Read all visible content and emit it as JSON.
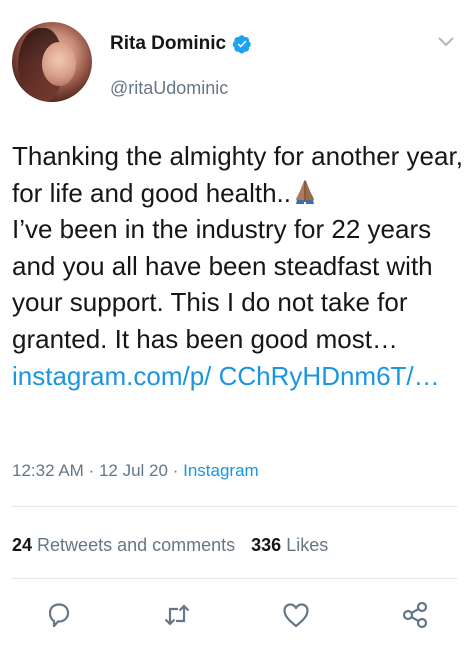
{
  "tweet": {
    "author_name": "Rita Dominic",
    "handle": "@ritaUdominic",
    "text_line_1": "Thanking the almighty for another year, for life and good health..",
    "text_line_2": "I’ve been in the industry for 22 years and you all have been steadfast with your support. This I do not take for granted. It has been good most… ",
    "link_text": "instagram.com/p/ CChRyHDnm6T/…",
    "time": "12:32 AM",
    "date": "12 Jul 20",
    "source": "Instagram"
  },
  "stats": {
    "retweets_count": "24",
    "retweets_label": "Retweets and comments",
    "likes_count": "336",
    "likes_label": "Likes"
  },
  "icons": {
    "verified": "verified-badge-icon",
    "chevron": "chevron-down-icon",
    "emoji": "folded-hands-emoji",
    "reply": "reply-icon",
    "retweet": "retweet-icon",
    "like": "heart-icon",
    "share": "share-icon"
  },
  "colors": {
    "link": "#1b95e0",
    "muted": "#657786",
    "text": "#14171a",
    "verified": "#1da1f2"
  }
}
